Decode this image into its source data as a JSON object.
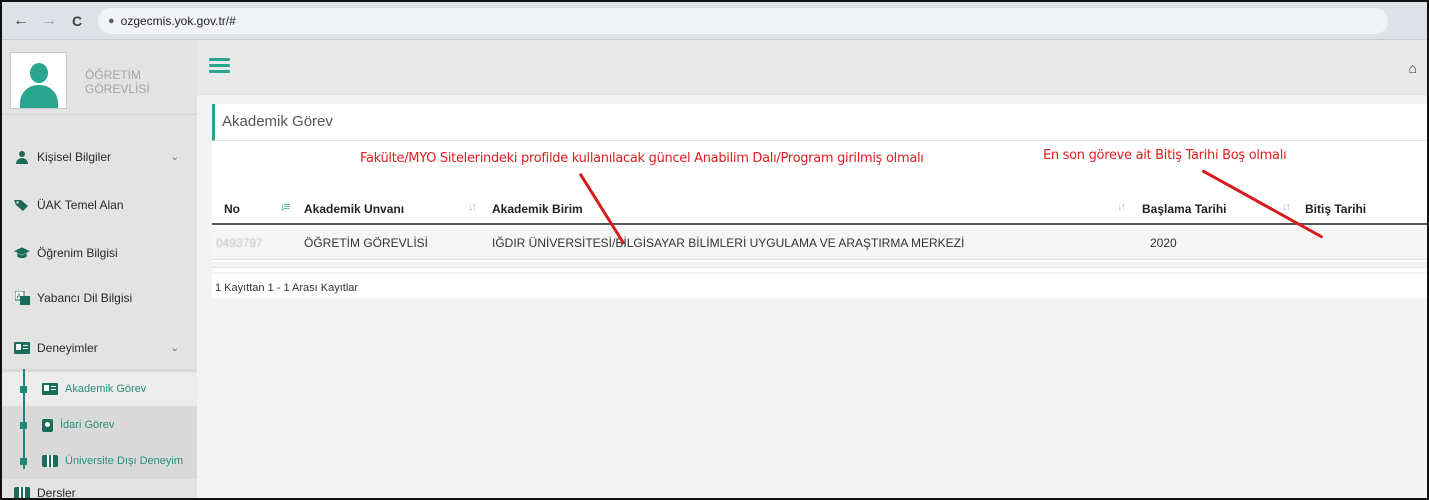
{
  "browser": {
    "back": "←",
    "forward": "→",
    "reload": "C",
    "lock": "🔒",
    "url": "ozgecmis.yok.gov.tr/#"
  },
  "profile": {
    "role_line1": "ÖĞRETİM",
    "role_line2": "GÖREVLİSİ"
  },
  "sidebar": {
    "items": [
      {
        "label": "Kişisel Bilgiler",
        "icon": "user-icon",
        "chevron": "⌄"
      },
      {
        "label": "ÜAK Temel Alan",
        "icon": "tag-icon"
      },
      {
        "label": "Öğrenim Bilgisi",
        "icon": "graduation-cap-icon"
      },
      {
        "label": "Yabancı Dil Bilgisi",
        "icon": "language-icon"
      },
      {
        "label": "Deneyimler",
        "icon": "id-card-icon",
        "chevron": "⌄"
      }
    ],
    "sub_items": [
      {
        "label": "Akademik Görev",
        "icon": "id-card-icon"
      },
      {
        "label": "İdari Görev",
        "icon": "badge-icon"
      },
      {
        "label": "Üniversite Dışı Deneyim",
        "icon": "briefcase-icon"
      }
    ],
    "last_item": {
      "label": "Dersler",
      "icon": "briefcase-icon"
    }
  },
  "topbar": {
    "home_icon": "⌂"
  },
  "panel": {
    "title": "Akademik Görev"
  },
  "table": {
    "columns": [
      "No",
      "Akademik Unvanı",
      "Akademik Birim",
      "Başlama Tarihi",
      "Bitiş Tarihi"
    ],
    "rows": [
      {
        "no": "0493797",
        "unvan": "ÖĞRETİM GÖREVLİSİ",
        "birim": "IĞDIR ÜNİVERSİTESİ/BİLGİSAYAR BİLİMLERİ UYGULAMA VE ARAŞTIRMA MERKEZİ",
        "baslama": "2020",
        "bitis": ""
      }
    ],
    "info": "1 Kayıttan 1 - 1 Arası Kayıtlar"
  },
  "annotations": {
    "left_note": "Fakülte/MYO Sitelerindeki profilde kullanılacak güncel Anabilim Dalı/Program girilmiş olmalı",
    "right_note": "En son göreve ait Bitiş Tarihi Boş olmalı"
  },
  "colors": {
    "accent": "#2aa58f",
    "annotation": "#e02020"
  }
}
